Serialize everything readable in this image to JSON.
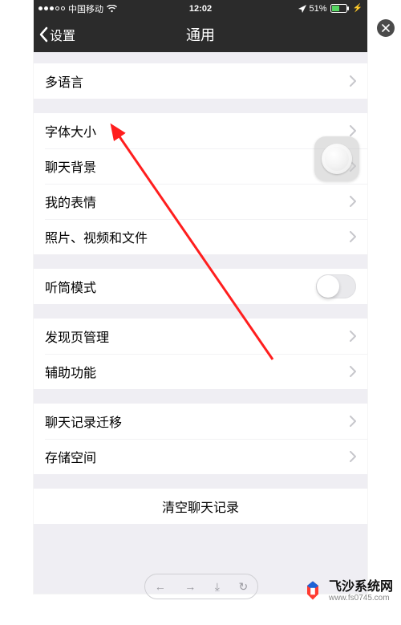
{
  "status": {
    "carrier": "中国移动",
    "time": "12:02",
    "battery_pct": "51%"
  },
  "nav": {
    "back_label": "设置",
    "title": "通用"
  },
  "groups": [
    {
      "items": [
        {
          "key": "language",
          "label": "多语言",
          "type": "chevron"
        }
      ]
    },
    {
      "items": [
        {
          "key": "font-size",
          "label": "字体大小",
          "type": "chevron"
        },
        {
          "key": "chat-bg",
          "label": "聊天背景",
          "type": "chevron"
        },
        {
          "key": "stickers",
          "label": "我的表情",
          "type": "chevron"
        },
        {
          "key": "media-files",
          "label": "照片、视频和文件",
          "type": "chevron"
        }
      ]
    },
    {
      "items": [
        {
          "key": "earpiece-mode",
          "label": "听筒模式",
          "type": "toggle",
          "value": false
        }
      ]
    },
    {
      "items": [
        {
          "key": "discover-manage",
          "label": "发现页管理",
          "type": "chevron"
        },
        {
          "key": "accessibility",
          "label": "辅助功能",
          "type": "chevron"
        }
      ]
    },
    {
      "items": [
        {
          "key": "chat-migrate",
          "label": "聊天记录迁移",
          "type": "chevron"
        },
        {
          "key": "storage",
          "label": "存储空间",
          "type": "chevron"
        }
      ]
    }
  ],
  "clear_button": "清空聊天记录",
  "watermark": {
    "brand": "飞沙系统网",
    "url": "www.fs0745.com"
  }
}
